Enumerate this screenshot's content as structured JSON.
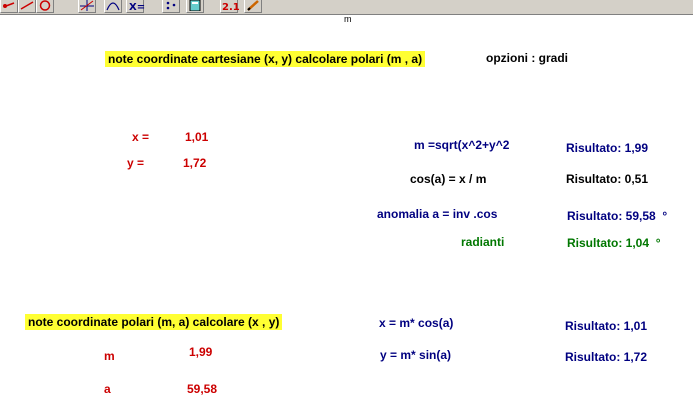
{
  "toolbar": {
    "buttons": [
      {
        "icon": "arrow-point-icon"
      },
      {
        "icon": "line-tool-icon"
      },
      {
        "icon": "circle-tool-icon"
      },
      {
        "icon": "axes-icon"
      },
      {
        "icon": "function-icon"
      },
      {
        "icon": "x-variable-icon"
      },
      {
        "icon": "dots-icon"
      },
      {
        "icon": "calculator-icon"
      },
      {
        "icon": "value-display-icon",
        "label": "2.1"
      },
      {
        "icon": "pencil-icon"
      }
    ]
  },
  "section1": {
    "title": "note coordinate cartesiane (x, y) calcolare polari (m , a)",
    "options": "opzioni : gradi",
    "x_label": "x =",
    "x_value": "1,01",
    "y_label": "y =",
    "y_value": "1,72",
    "formulas": [
      {
        "expr": "m =sqrt(x^2+y^2",
        "result": "Risultato: 1,99"
      },
      {
        "expr": "cos(a) = x / m",
        "result": "Risultato: 0,51"
      },
      {
        "expr": "anomalia a = inv .cos",
        "result": "Risultato: 59,58",
        "unit": "°"
      },
      {
        "expr": "radianti",
        "result": "Risultato: 1,04",
        "unit": "°"
      }
    ]
  },
  "section2": {
    "title": "note coordinate polari (m, a) calcolare (x , y)",
    "m_label": "m",
    "m_value": "1,99",
    "a_label": "a",
    "a_value": "59,58",
    "formulas": [
      {
        "expr": "x = m* cos(a)",
        "result": "Risultato: 1,01"
      },
      {
        "expr": "y = m* sin(a)",
        "result": "Risultato: 1,72"
      }
    ]
  },
  "colors": {
    "highlight": "#ffff33",
    "input_red": "#cc0000",
    "formula_navy": "#000080",
    "radian_green": "#007700",
    "toolbar_gray": "#d4d0c8"
  }
}
